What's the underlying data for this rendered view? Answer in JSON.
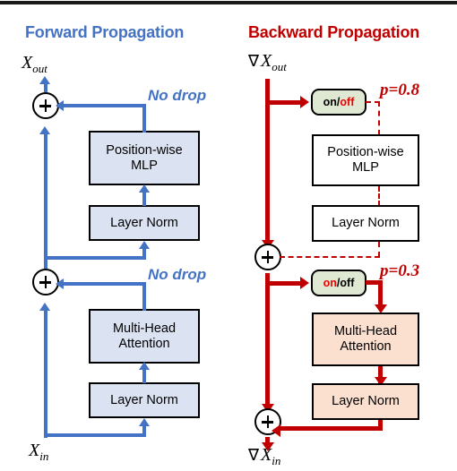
{
  "diagram": {
    "title_forward": "Forward Propagation",
    "title_backward": "Backward Propagation",
    "colors": {
      "forward_accent": "#4472C4",
      "backward_accent": "#C00000",
      "forward_box_fill": "#DBE2F1",
      "backward_box_fill": "#FBE0CF",
      "dropped_box_fill": "#FFFFFF",
      "badge_fill": "#DFE8D3",
      "badge_highlight": "#EE0000"
    }
  },
  "forward": {
    "label_out_symbol": "X",
    "label_out_sub": "out",
    "label_in_symbol": "X",
    "label_in_sub": "in",
    "annotation_top": "No drop",
    "annotation_bottom": "No drop",
    "blocks": {
      "mlp": "Position-wise\nMLP",
      "layernorm_top": "Layer Norm",
      "attention": "Multi-Head\nAttention",
      "layernorm_bottom": "Layer Norm"
    },
    "residual_op": "+"
  },
  "backward": {
    "nabla": "∇",
    "label_out_symbol": "X",
    "label_out_sub": "out",
    "label_in_symbol": "X",
    "label_in_sub": "in",
    "gate_top": {
      "on": "on",
      "sep": "/",
      "off": "off",
      "active": "off",
      "prob_label": "p=0.8"
    },
    "gate_bottom": {
      "on": "on",
      "sep": "/",
      "off": "off",
      "active": "on",
      "prob_label": "p=0.3"
    },
    "blocks": {
      "mlp": "Position-wise\nMLP",
      "layernorm_top": "Layer Norm",
      "attention": "Multi-Head\nAttention",
      "layernorm_bottom": "Layer Norm"
    },
    "residual_op": "+"
  }
}
